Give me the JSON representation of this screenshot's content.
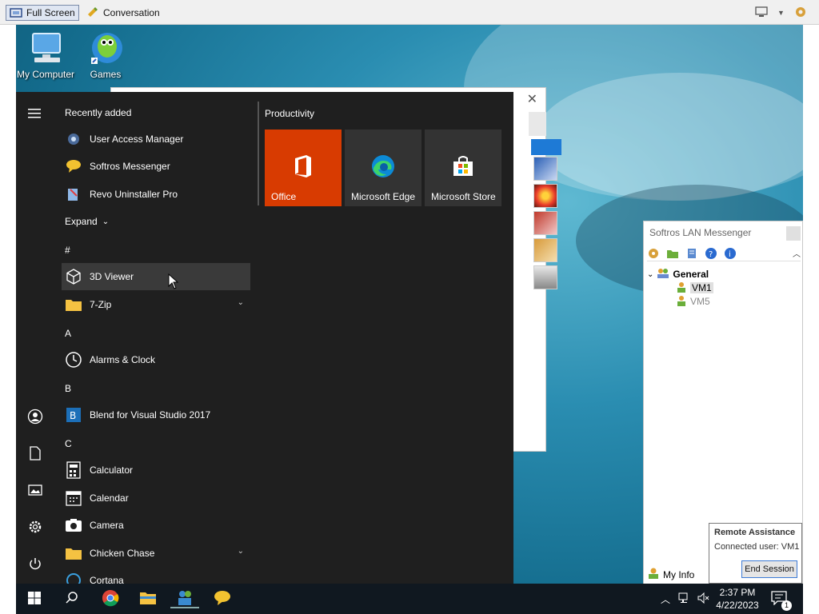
{
  "viewer": {
    "full_screen_label": "Full Screen",
    "conversation_label": "Conversation"
  },
  "desktop": {
    "icons": [
      {
        "label": "My Computer",
        "icon": "my-computer-icon"
      },
      {
        "label": "Games",
        "icon": "games-icon"
      }
    ]
  },
  "start_menu": {
    "recently_added_label": "Recently added",
    "recent": [
      {
        "label": "User Access Manager",
        "icon": "gear-icon"
      },
      {
        "label": "Softros Messenger",
        "icon": "messenger-icon"
      },
      {
        "label": "Revo Uninstaller Pro",
        "icon": "uninstaller-icon"
      }
    ],
    "expand_label": "Expand",
    "groups": [
      {
        "letter": "#",
        "apps": [
          {
            "label": "3D Viewer",
            "icon": "cube-icon",
            "expandable": false
          },
          {
            "label": "7-Zip",
            "icon": "folder-icon",
            "expandable": true
          }
        ]
      },
      {
        "letter": "A",
        "apps": [
          {
            "label": "Alarms & Clock",
            "icon": "clock-icon",
            "expandable": false
          }
        ]
      },
      {
        "letter": "B",
        "apps": [
          {
            "label": "Blend for Visual Studio 2017",
            "icon": "blend-icon",
            "expandable": false
          }
        ]
      },
      {
        "letter": "C",
        "apps": [
          {
            "label": "Calculator",
            "icon": "calculator-icon",
            "expandable": false
          },
          {
            "label": "Calendar",
            "icon": "calendar-icon",
            "expandable": false
          },
          {
            "label": "Camera",
            "icon": "camera-icon",
            "expandable": false
          },
          {
            "label": "Chicken Chase",
            "icon": "folder-icon",
            "expandable": true
          },
          {
            "label": "Cortana",
            "icon": "cortana-icon",
            "expandable": false
          }
        ]
      }
    ],
    "tiles_group_title": "Productivity",
    "tiles": [
      {
        "label": "Office",
        "color": "#d83b01"
      },
      {
        "label": "Microsoft Edge",
        "color": "#333333"
      },
      {
        "label": "Microsoft Store",
        "color": "#333333"
      }
    ]
  },
  "lan_messenger": {
    "title": "Softros LAN Messenger",
    "group": "General",
    "users": [
      "VM1",
      "VM5"
    ],
    "my_info_label": "My Info"
  },
  "remote_assistance": {
    "title": "Remote Assistance",
    "connected": "Connected user: VM1",
    "end_session_label": "End Session"
  },
  "taskbar": {
    "time": "2:37 PM",
    "date": "4/22/2023",
    "notification_count": "1"
  },
  "colors": {
    "start_bg": "#1f1f1f",
    "office_tile": "#d83b01",
    "taskbar_bg": "#101820"
  }
}
